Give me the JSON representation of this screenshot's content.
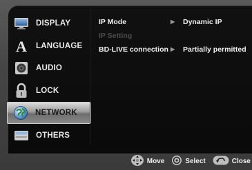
{
  "sidebar": {
    "items": [
      {
        "label": "DISPLAY",
        "icon": "display-icon",
        "selected": false
      },
      {
        "label": "LANGUAGE",
        "icon": "language-icon",
        "selected": false
      },
      {
        "label": "AUDIO",
        "icon": "audio-icon",
        "selected": false
      },
      {
        "label": "LOCK",
        "icon": "lock-icon",
        "selected": false
      },
      {
        "label": "NETWORK",
        "icon": "network-icon",
        "selected": true
      },
      {
        "label": "OTHERS",
        "icon": "others-icon",
        "selected": false
      }
    ]
  },
  "settings": [
    {
      "label": "IP Mode",
      "value": "Dynamic IP",
      "enabled": true
    },
    {
      "label": "IP Setting",
      "value": "",
      "enabled": false
    },
    {
      "label": "BD-LIVE connection",
      "value": "Partially permitted",
      "enabled": true
    }
  ],
  "footer": {
    "move": "Move",
    "select": "Select",
    "close": "Close"
  },
  "colors": {
    "panel_bg": "#0a0a0a",
    "screen_bg": "#454545",
    "selected_bg": "#9a9a9a",
    "text": "#f0f0f0",
    "disabled_text": "#4c4c4c"
  }
}
